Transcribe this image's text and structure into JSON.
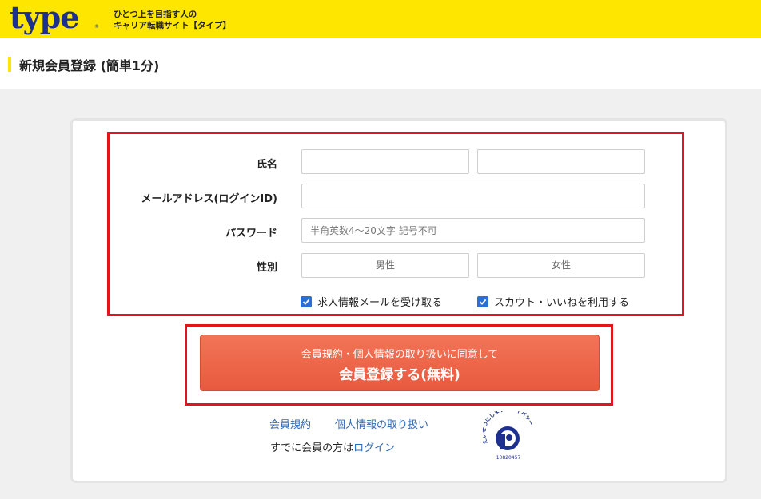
{
  "header": {
    "logo_text": "type",
    "logo_reg": "®",
    "tagline_line1": "ひとつ上を目指す人の",
    "tagline_line2": "キャリア転職サイト【タイプ】"
  },
  "page": {
    "title": "新規会員登録 (簡単1分)"
  },
  "form": {
    "name_label": "氏名",
    "email_label": "メールアドレス(ログインID)",
    "password_label": "パスワード",
    "password_placeholder": "半角英数4〜20文字 記号不可",
    "gender_label": "性別",
    "gender_options": [
      "男性",
      "女性"
    ],
    "checkbox_job_mail": "求人情報メールを受け取る",
    "checkbox_scout": "スカウト・いいねを利用する"
  },
  "submit": {
    "subtext": "会員規約・個人情報の取り扱いに同意して",
    "label": "会員登録する(無料)"
  },
  "links": {
    "terms": "会員規約",
    "privacy": "個人情報の取り扱い",
    "existing_prefix": "すでに会員の方は",
    "login": "ログイン"
  },
  "privacy_mark": {
    "arc_text": "たいせつにしますプライバシー",
    "number": "10820457"
  },
  "colors": {
    "brand_yellow": "#ffe600",
    "brand_navy": "#1d2f8f",
    "cta_orange": "#e85a3f",
    "highlight_red": "#e1151c",
    "link_blue": "#2f69b8",
    "checkbox_blue": "#2a6fd6"
  }
}
